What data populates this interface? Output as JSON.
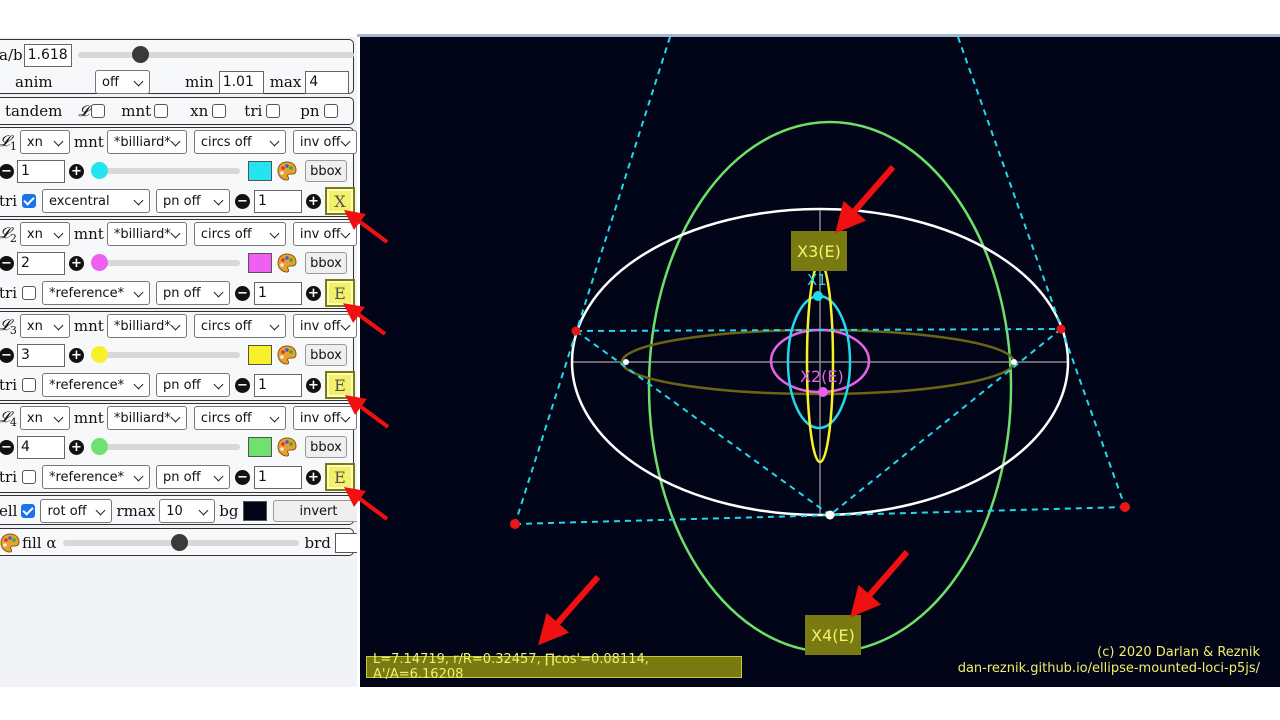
{
  "top": {
    "ab_label": "a/b",
    "ab_value": "1.618",
    "anim_label": "anim",
    "anim_value": "off",
    "min_label": "min",
    "min_value": "1.01",
    "max_label": "max",
    "max_value": "4"
  },
  "tandem": {
    "tandem_label": "tandem",
    "L_label": "𝓛",
    "mnt_label": "mnt",
    "xn_label": "xn",
    "tri_label": "tri",
    "pn_label": "pn"
  },
  "loci": [
    {
      "name": "𝓛",
      "sub": "1",
      "xn": "xn",
      "mnt_label": "mnt",
      "mnt": "*billiard*",
      "circs": "circs off",
      "inv": "inv off",
      "value": "1",
      "color": "#22e5f0",
      "bbox": "bbox",
      "tri_label": "tri",
      "tri_checked": true,
      "tri": "excentral",
      "pn": "pn off",
      "tri_value": "1",
      "tri_btn": "X"
    },
    {
      "name": "𝓛",
      "sub": "2",
      "xn": "xn",
      "mnt_label": "mnt",
      "mnt": "*billiard*",
      "circs": "circs off",
      "inv": "inv off",
      "value": "2",
      "color": "#f060f0",
      "bbox": "bbox",
      "tri_label": "tri",
      "tri_checked": false,
      "tri": "*reference*",
      "pn": "pn off",
      "tri_value": "1",
      "tri_btn": "E"
    },
    {
      "name": "𝓛",
      "sub": "3",
      "xn": "xn",
      "mnt_label": "mnt",
      "mnt": "*billiard*",
      "circs": "circs off",
      "inv": "inv off",
      "value": "3",
      "color": "#f8f028",
      "bbox": "bbox",
      "tri_label": "tri",
      "tri_checked": false,
      "tri": "*reference*",
      "pn": "pn off",
      "tri_value": "1",
      "tri_btn": "E"
    },
    {
      "name": "𝓛",
      "sub": "4",
      "xn": "xn",
      "mnt_label": "mnt",
      "mnt": "*billiard*",
      "circs": "circs off",
      "inv": "inv off",
      "value": "4",
      "color": "#70e070",
      "bbox": "bbox",
      "tri_label": "tri",
      "tri_checked": false,
      "tri": "*reference*",
      "pn": "pn off",
      "tri_value": "1",
      "tri_btn": "E"
    }
  ],
  "ell": {
    "label": "ell",
    "checked": true,
    "rot": "rot off",
    "rmax_label": "rmax",
    "rmax": "10",
    "bg_label": "bg",
    "bg_color": "#020518",
    "invert": "invert"
  },
  "fill": {
    "label": "fill α",
    "brd_label": "brd"
  },
  "canvas": {
    "labels": {
      "x3": "X3(E)",
      "x1": "X1",
      "x2": "X2(E)",
      "x4": "X4(E)"
    },
    "info": "L=7.14719, r/R=0.32457, ∏cos'=0.08114, A'/A=6.16208",
    "credit1": "(c) 2020 Darlan & Reznik",
    "credit2": "dan-reznik.github.io/ellipse-mounted-loci-p5js/"
  }
}
